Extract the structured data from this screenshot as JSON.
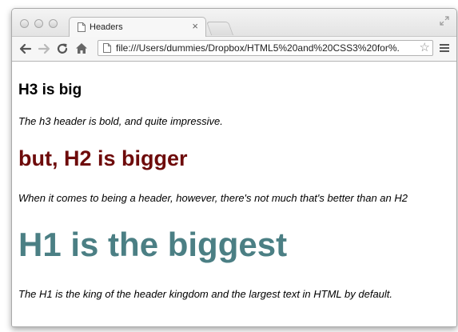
{
  "browser": {
    "tab": {
      "title": "Headers",
      "close_glyph": "×"
    },
    "address_bar": {
      "url": "file:///Users/dummies/Dropbox/HTML5%20and%20CSS3%20for%...",
      "bookmark_glyph": "☆"
    }
  },
  "page": {
    "h3": "H3 is big",
    "p1": "The h3 header is bold, and quite impressive.",
    "h2": "but, H2 is bigger",
    "p2": "When it comes to being a header, however, there's not much that's better than an H2",
    "h1": "H1 is the biggest",
    "p3": "The H1 is the king of the header kingdom and the largest text in HTML by default."
  },
  "colors": {
    "h2": "#6e0b0b",
    "h1": "#4b7f84",
    "body_text": "#000000"
  },
  "icons": [
    "close-window-icon",
    "minimize-window-icon",
    "zoom-window-icon",
    "page-icon",
    "new-tab-icon",
    "fullscreen-icon",
    "back-arrow-icon",
    "forward-arrow-icon",
    "reload-icon",
    "home-icon",
    "bookmark-star-icon",
    "menu-icon"
  ]
}
